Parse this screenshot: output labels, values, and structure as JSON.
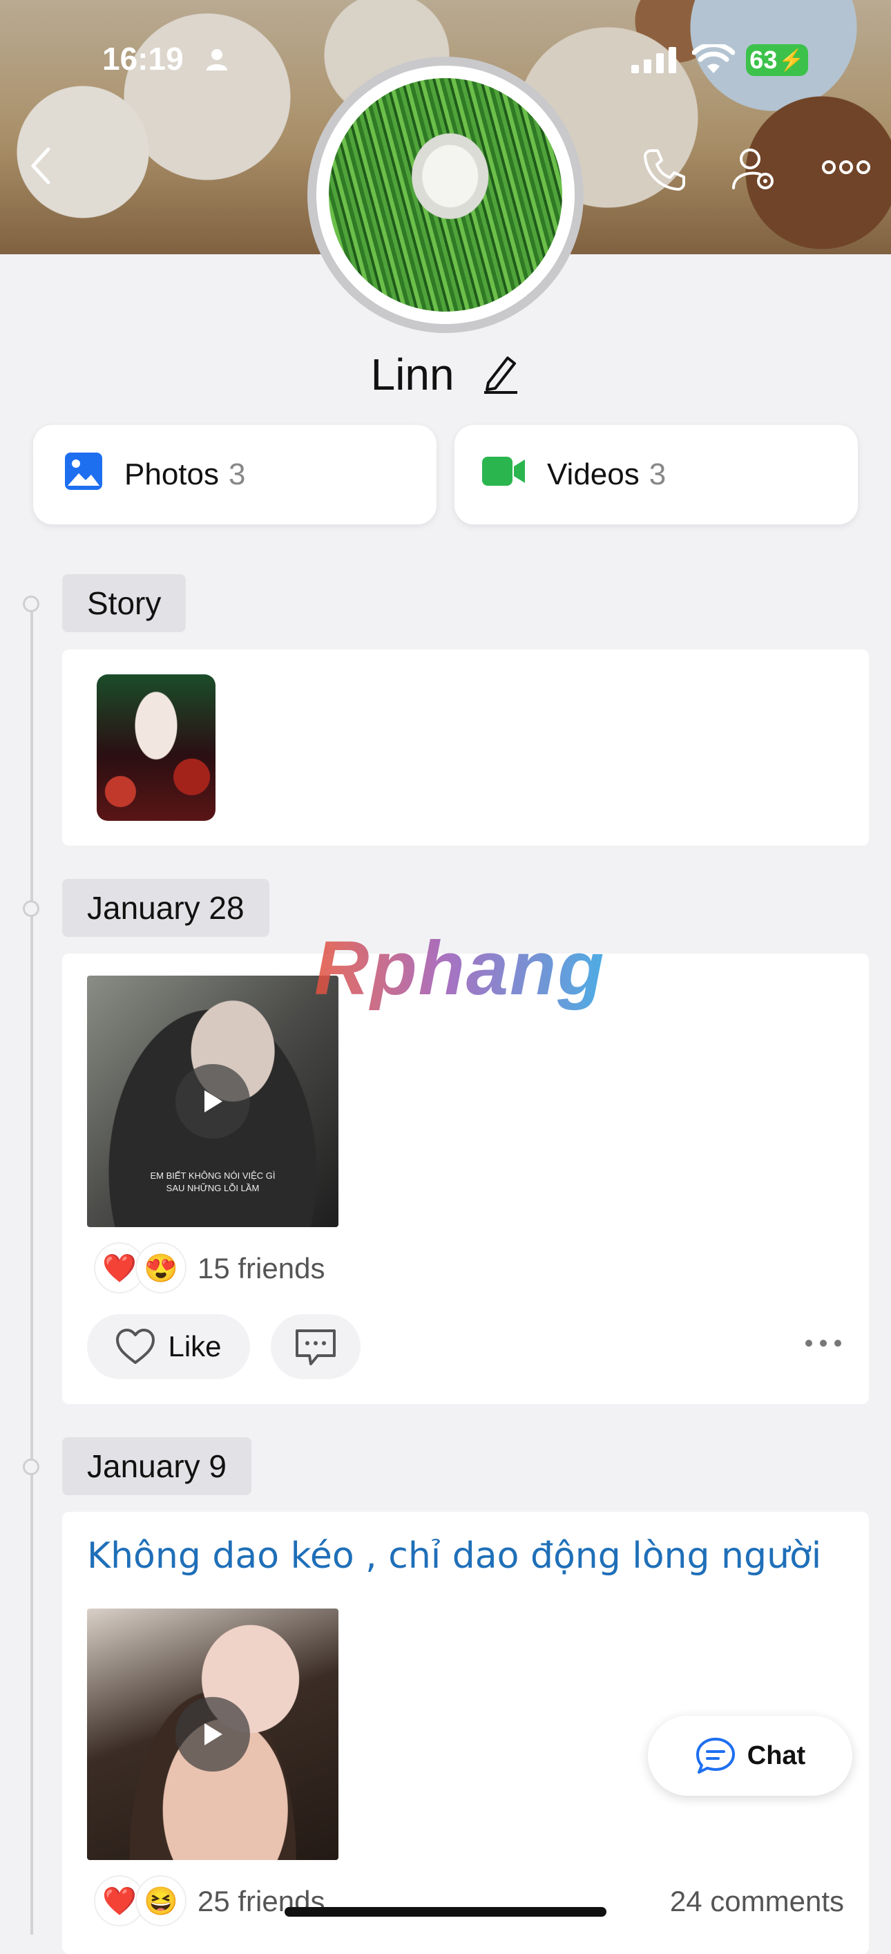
{
  "status_bar": {
    "time": "16:19",
    "battery": "63"
  },
  "profile": {
    "name": "Linn"
  },
  "media": {
    "photos": {
      "label": "Photos",
      "count": "3"
    },
    "videos": {
      "label": "Videos",
      "count": "3"
    }
  },
  "sections": {
    "story": {
      "label": "Story"
    },
    "jan28": {
      "date": "January 28",
      "thumb_caption_1": "EM BIẾT KHÔNG NÓI VIỆC GÌ",
      "thumb_caption_2": "SAU NHỮNG LỖI LẦM",
      "reactions": "15 friends",
      "like_label": "Like"
    },
    "jan9": {
      "date": "January 9",
      "caption": "Không dao kéo , chỉ dao động lòng người",
      "reactions": "25 friends",
      "comments": "24 comments"
    }
  },
  "watermark": "Rphang",
  "chat": {
    "label": "Chat"
  }
}
